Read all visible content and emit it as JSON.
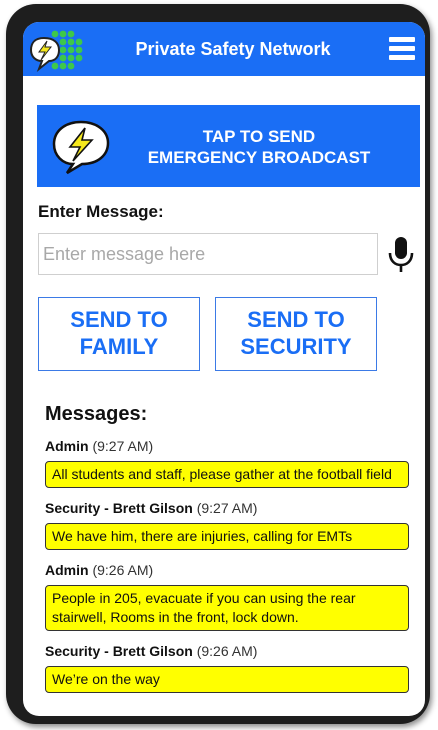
{
  "header": {
    "title": "Private Safety Network",
    "logo_icon": "lightning-speech-logo-icon",
    "menu_icon": "hamburger-menu-icon"
  },
  "broadcast": {
    "line1": "TAP TO SEND",
    "line2": "EMERGENCY BROADCAST",
    "icon": "lightning-bolt-icon"
  },
  "compose": {
    "label": "Enter Message:",
    "placeholder": "Enter message here",
    "value": "",
    "mic_icon": "microphone-icon"
  },
  "actions": {
    "family": {
      "line1": "SEND TO",
      "line2": "FAMILY"
    },
    "security": {
      "line1": "SEND TO",
      "line2": "SECURITY"
    }
  },
  "messages": {
    "title": "Messages:",
    "items": [
      {
        "sender": "Admin",
        "time": "(9:27 AM)",
        "text": "All students and staff, please gather at the football field"
      },
      {
        "sender": "Security - Brett Gilson",
        "time": "(9:27 AM)",
        "text": "We have him, there are injuries, calling for EMTs"
      },
      {
        "sender": "Admin",
        "time": "(9:26 AM)",
        "text": "People in 205, evacuate if you can using the rear stairwell, Rooms in the front, lock down."
      },
      {
        "sender": "Security - Brett Gilson",
        "time": "(9:26 AM)",
        "text": "We’re on the way"
      }
    ]
  },
  "colors": {
    "brand_blue": "#1a6ef5",
    "message_bubble": "#ffff00",
    "logo_green": "#3ec84a",
    "bolt_yellow": "#f5e81c"
  }
}
